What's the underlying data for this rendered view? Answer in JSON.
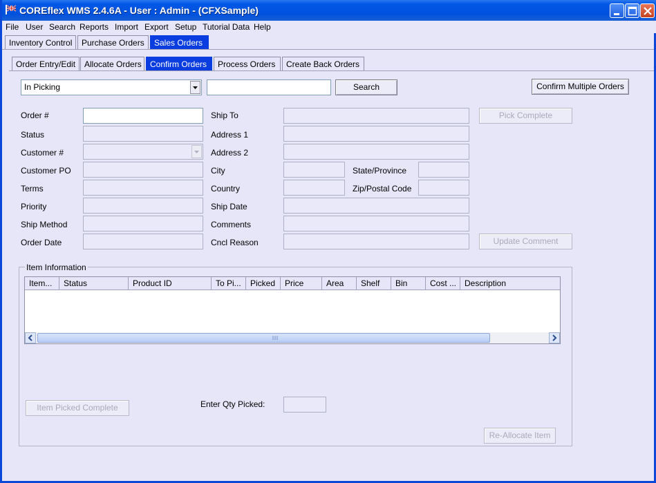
{
  "window": {
    "title": "COREflex WMS 2.4.6A - User : Admin - (CFXSample)"
  },
  "menu": [
    "File",
    "User",
    "Search",
    "Reports",
    "Import",
    "Export",
    "Setup",
    "Tutorial Data",
    "Help"
  ],
  "main_tabs": [
    "Inventory Control",
    "Purchase Orders",
    "Sales Orders"
  ],
  "main_tabs_active": "Sales Orders",
  "sub_tabs": [
    "Order Entry/Edit",
    "Allocate Orders",
    "Confirm Orders",
    "Process Orders",
    "Create Back Orders"
  ],
  "sub_tabs_active": "Confirm Orders",
  "filter": {
    "status_selected": "In Picking",
    "search_value": "",
    "search_label": "Search",
    "confirm_multiple_label": "Confirm Multiple Orders"
  },
  "order_form": {
    "order_no_label": "Order #",
    "status_label": "Status",
    "customer_no_label": "Customer #",
    "customer_po_label": "Customer PO",
    "terms_label": "Terms",
    "priority_label": "Priority",
    "ship_method_label": "Ship Method",
    "order_date_label": "Order Date",
    "ship_to_label": "Ship To",
    "address1_label": "Address 1",
    "address2_label": "Address 2",
    "city_label": "City",
    "state_label": "State/Province",
    "country_label": "Country",
    "zip_label": "Zip/Postal Code",
    "ship_date_label": "Ship Date",
    "comments_label": "Comments",
    "cancel_reason_label": "Cncl Reason"
  },
  "actions": {
    "pick_complete": "Pick Complete",
    "update_comment": "Update Comment",
    "item_picked_complete": "Item Picked Complete",
    "reallocate_item": "Re-Allocate Item"
  },
  "item_info": {
    "group_title": "Item Information",
    "columns": [
      "Item...",
      "Status",
      "Product ID",
      "To Pi...",
      "Picked",
      "Price",
      "Area",
      "Shelf",
      "Bin",
      "Cost ...",
      "Description"
    ],
    "rows": [],
    "qty_label": "Enter Qty Picked:"
  },
  "colors": {
    "active_tab": "#0a3de0",
    "title_bar": "#0054e3",
    "window_bg": "#e6e6f8"
  },
  "icons": {
    "app": "flag-icon",
    "minimize": "minimize-icon",
    "maximize": "maximize-icon",
    "close": "close-icon"
  }
}
